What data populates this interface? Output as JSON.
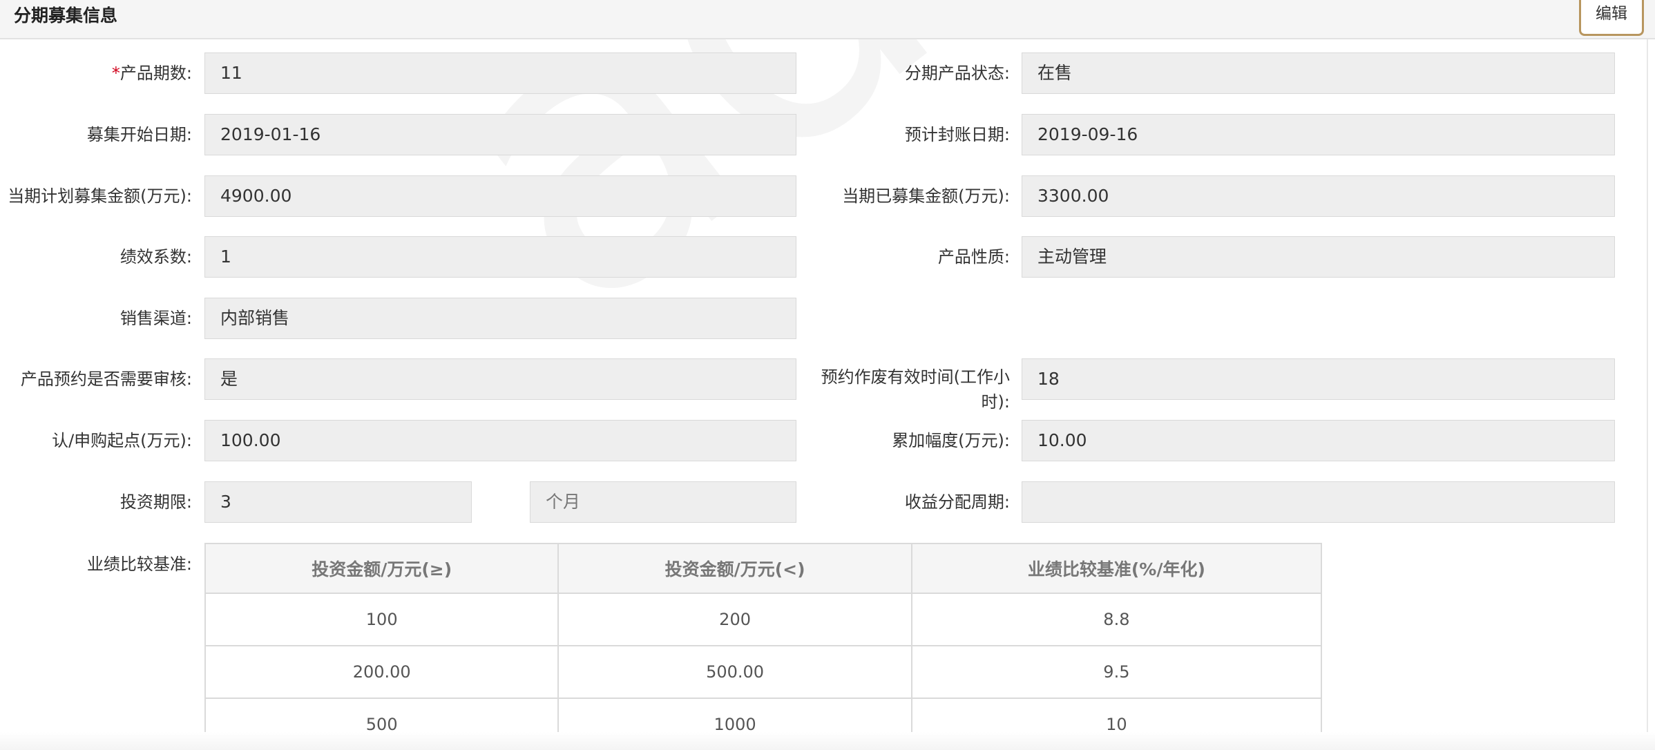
{
  "header": {
    "title": "分期募集信息",
    "edit_label": "编辑"
  },
  "form": {
    "period": {
      "required_mark": "*",
      "label": "产品期数:",
      "value": "11"
    },
    "status": {
      "label": "分期产品状态:",
      "value": "在售"
    },
    "raise_start": {
      "label": "募集开始日期:",
      "value": "2019-01-16"
    },
    "close_date": {
      "label": "预计封账日期:",
      "value": "2019-09-16"
    },
    "planned_amount": {
      "label": "当期计划募集金额(万元):",
      "value": "4900.00"
    },
    "raised_amount": {
      "label": "当期已募集金额(万元):",
      "value": "3300.00"
    },
    "perf_coef": {
      "label": "绩效系数:",
      "value": "1"
    },
    "nature": {
      "label": "产品性质:",
      "value": "主动管理"
    },
    "channel": {
      "label": "销售渠道:",
      "value": "内部销售"
    },
    "review": {
      "label": "产品预约是否需要审核:",
      "value": "是"
    },
    "void_time": {
      "label_line1": "预约作废有效时间(工作小",
      "label_line2": "时):",
      "value": "18"
    },
    "min_subscribe": {
      "label": "认/申购起点(万元):",
      "value": "100.00"
    },
    "increment": {
      "label": "累加幅度(万元):",
      "value": "10.00"
    },
    "term": {
      "label": "投资期限:",
      "value": "3",
      "unit": "个月"
    },
    "distribution": {
      "label": "收益分配周期:",
      "value": ""
    },
    "benchmark_label": "业绩比较基准:"
  },
  "benchmark_table": {
    "headers": [
      "投资金额/万元(≥)",
      "投资金额/万元(<)",
      "业绩比较基准(%/年化)"
    ],
    "rows": [
      [
        "100",
        "200",
        "8.8"
      ],
      [
        "200.00",
        "500.00",
        "9.5"
      ],
      [
        "500",
        "1000",
        "10"
      ]
    ]
  },
  "watermark": "admin"
}
